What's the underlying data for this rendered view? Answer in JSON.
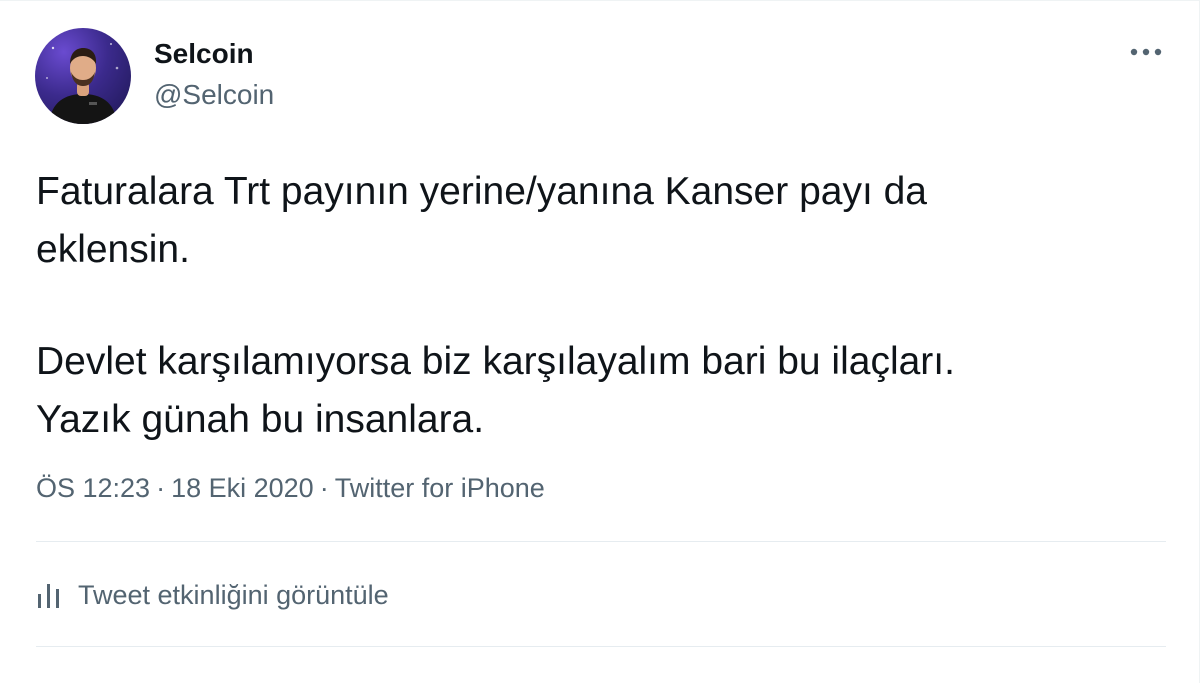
{
  "user": {
    "display_name": "Selcoin",
    "handle": "@Selcoin"
  },
  "tweet": {
    "paragraph_1": "Faturalara Trt payının yerine/yanına Kanser payı da\neklensin.",
    "paragraph_2": "Devlet karşılamıyorsa biz karşılayalım bari bu ilaçları.\nYazık günah bu insanlara."
  },
  "meta": {
    "time": "ÖS 12:23",
    "separator": "·",
    "date": "18 Eki 2020",
    "source": "Twitter for iPhone"
  },
  "actions": {
    "activity_label": "Tweet etkinliğini görüntüle"
  },
  "icons": {
    "more": "more-horizontal-icon",
    "activity": "analytics-bars-icon"
  },
  "colors": {
    "text_primary": "#0f1419",
    "text_secondary": "#536471",
    "divider": "#e6ecf0"
  }
}
